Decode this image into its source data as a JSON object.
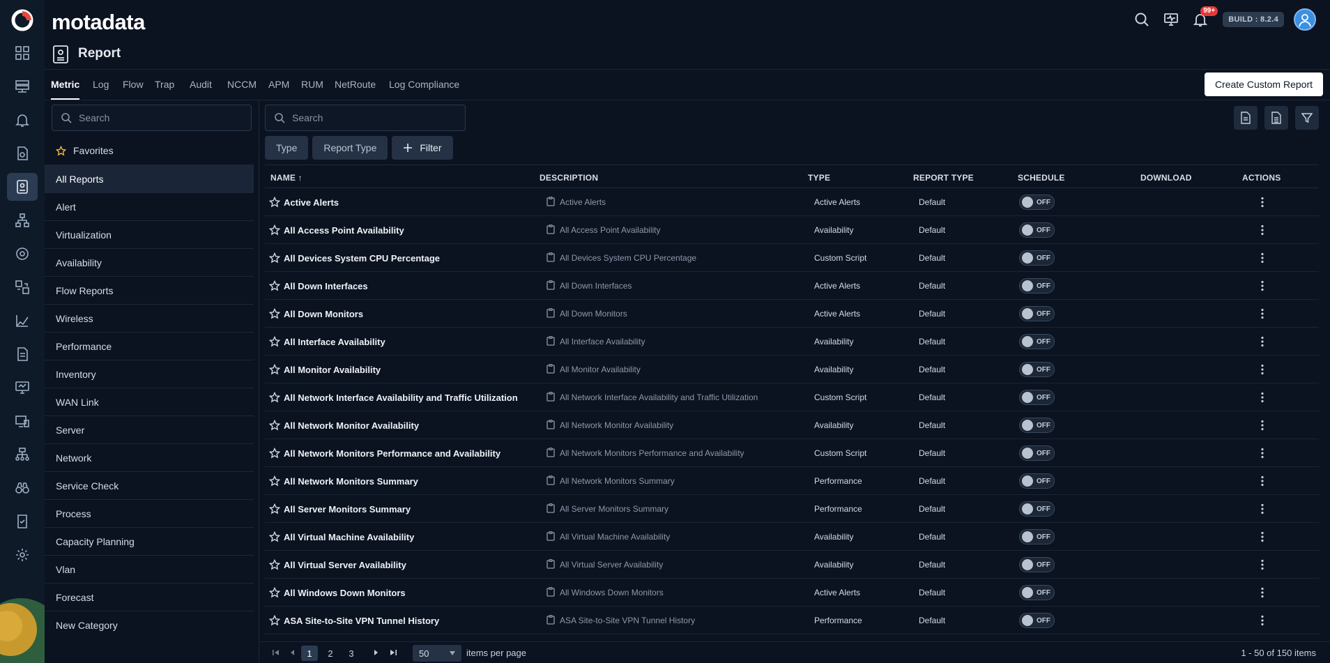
{
  "app": {
    "brand": "motadata",
    "build": "BUILD : 8.2.4",
    "notifications": "99+"
  },
  "header": {
    "title": "Report"
  },
  "tabs": [
    {
      "label": "Metric",
      "active": true
    },
    {
      "label": "Log"
    },
    {
      "label": "Flow"
    },
    {
      "label": "Trap"
    },
    {
      "label": "Audit"
    },
    {
      "label": "NCCM"
    },
    {
      "label": "APM"
    },
    {
      "label": "RUM"
    },
    {
      "label": "NetRoute"
    },
    {
      "label": "Log Compliance"
    }
  ],
  "create_button": "Create Custom Report",
  "sidebar": {
    "search_placeholder": "Search",
    "favorites": "Favorites",
    "categories": [
      "All Reports",
      "Alert",
      "Virtualization",
      "Availability",
      "Flow Reports",
      "Wireless",
      "Performance",
      "Inventory",
      "WAN Link",
      "Server",
      "Network",
      "Service Check",
      "Process",
      "Capacity Planning",
      "Vlan",
      "Forecast",
      "New Category"
    ],
    "active": "All Reports"
  },
  "main": {
    "search_placeholder": "Search",
    "chips": [
      "Type",
      "Report Type"
    ],
    "filter_label": "Filter"
  },
  "table": {
    "columns": {
      "name": "NAME ↑",
      "description": "DESCRIPTION",
      "type": "TYPE",
      "report_type": "REPORT TYPE",
      "schedule": "SCHEDULE",
      "download": "DOWNLOAD",
      "actions": "ACTIONS"
    },
    "rows": [
      {
        "name": "Active Alerts",
        "description": "Active Alerts",
        "type": "Active Alerts",
        "report_type": "Default",
        "schedule": "OFF"
      },
      {
        "name": "All Access Point Availability",
        "description": "All Access Point Availability",
        "type": "Availability",
        "report_type": "Default",
        "schedule": "OFF"
      },
      {
        "name": "All Devices System CPU Percentage",
        "description": "All Devices System CPU Percentage",
        "type": "Custom Script",
        "report_type": "Default",
        "schedule": "OFF"
      },
      {
        "name": "All Down Interfaces",
        "description": "All Down Interfaces",
        "type": "Active Alerts",
        "report_type": "Default",
        "schedule": "OFF"
      },
      {
        "name": "All Down Monitors",
        "description": "All Down Monitors",
        "type": "Active Alerts",
        "report_type": "Default",
        "schedule": "OFF"
      },
      {
        "name": "All Interface Availability",
        "description": "All Interface Availability",
        "type": "Availability",
        "report_type": "Default",
        "schedule": "OFF"
      },
      {
        "name": "All Monitor Availability",
        "description": "All Monitor Availability",
        "type": "Availability",
        "report_type": "Default",
        "schedule": "OFF"
      },
      {
        "name": "All Network Interface Availability and Traffic Utilization",
        "description": "All Network Interface Availability and Traffic Utilization",
        "type": "Custom Script",
        "report_type": "Default",
        "schedule": "OFF"
      },
      {
        "name": "All Network Monitor Availability",
        "description": "All Network Monitor Availability",
        "type": "Availability",
        "report_type": "Default",
        "schedule": "OFF"
      },
      {
        "name": "All Network Monitors Performance and Availability",
        "description": "All Network Monitors Performance and Availability",
        "type": "Custom Script",
        "report_type": "Default",
        "schedule": "OFF"
      },
      {
        "name": "All Network Monitors Summary",
        "description": "All Network Monitors Summary",
        "type": "Performance",
        "report_type": "Default",
        "schedule": "OFF"
      },
      {
        "name": "All Server Monitors Summary",
        "description": "All Server Monitors Summary",
        "type": "Performance",
        "report_type": "Default",
        "schedule": "OFF"
      },
      {
        "name": "All Virtual Machine Availability",
        "description": "All Virtual Machine Availability",
        "type": "Availability",
        "report_type": "Default",
        "schedule": "OFF"
      },
      {
        "name": "All Virtual Server Availability",
        "description": "All Virtual Server Availability",
        "type": "Availability",
        "report_type": "Default",
        "schedule": "OFF"
      },
      {
        "name": "All Windows Down Monitors",
        "description": "All Windows Down Monitors",
        "type": "Active Alerts",
        "report_type": "Default",
        "schedule": "OFF"
      },
      {
        "name": "ASA Site-to-Site VPN Tunnel History",
        "description": "ASA Site-to-Site VPN Tunnel History",
        "type": "Performance",
        "report_type": "Default",
        "schedule": "OFF"
      }
    ]
  },
  "pagination": {
    "pages": [
      "1",
      "2",
      "3"
    ],
    "current": "1",
    "per_page": "50",
    "items_per_page_label": "items per page",
    "range": "1 - 50 of 150 items"
  },
  "colors": {
    "background": "#0b1220",
    "rail": "#0e1a28",
    "accent_red": "#e53935",
    "brand_logo": "#e8473b"
  }
}
